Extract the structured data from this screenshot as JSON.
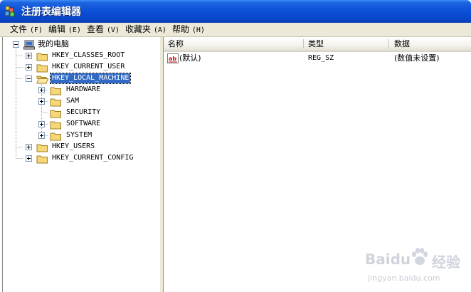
{
  "window": {
    "title": "注册表编辑器",
    "icon": "registry-editor-icon"
  },
  "menu": [
    {
      "label": "文件",
      "key": "(F)"
    },
    {
      "label": "编辑",
      "key": "(E)"
    },
    {
      "label": "查看",
      "key": "(V)"
    },
    {
      "label": "收藏夹",
      "key": "(A)"
    },
    {
      "label": "帮助",
      "key": "(H)"
    }
  ],
  "tree": {
    "root": "我的电脑",
    "hives": [
      {
        "label": "HKEY_CLASSES_ROOT",
        "expanded": false
      },
      {
        "label": "HKEY_CURRENT_USER",
        "expanded": false
      },
      {
        "label": "HKEY_LOCAL_MACHINE",
        "expanded": true,
        "selected": true
      },
      {
        "label": "HKEY_USERS",
        "expanded": false
      },
      {
        "label": "HKEY_CURRENT_CONFIG",
        "expanded": false
      }
    ],
    "hklm_children": [
      {
        "label": "HARDWARE",
        "has_children": true
      },
      {
        "label": "SAM",
        "has_children": true
      },
      {
        "label": "SECURITY",
        "has_children": false
      },
      {
        "label": "SOFTWARE",
        "has_children": true
      },
      {
        "label": "SYSTEM",
        "has_children": true
      }
    ]
  },
  "list": {
    "columns": [
      "名称",
      "类型",
      "数据"
    ],
    "rows": [
      {
        "name": "(默认)",
        "type": "REG_SZ",
        "data": "(数值未设置)",
        "icon": "string-value-icon"
      }
    ]
  },
  "watermark": {
    "brand": "Baidu",
    "brand_cn": "经验",
    "url": "jingyan.baidu.com"
  },
  "colors": {
    "titlebar": "#0a4fd6",
    "selection": "#316ac5",
    "menubar": "#ece9d8",
    "folder": "#f5d77a"
  }
}
